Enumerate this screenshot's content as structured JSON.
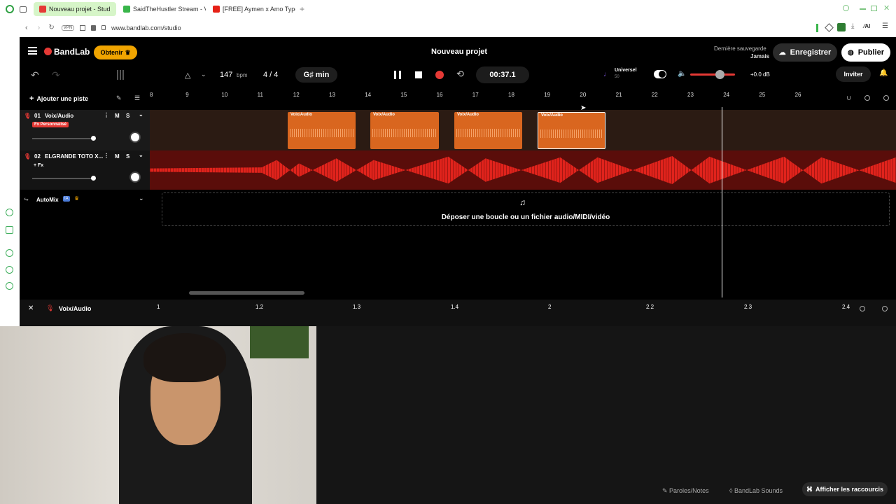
{
  "browser": {
    "tabs": [
      "Nouveau projet - Stud",
      "SaidTheHustler Stream - V",
      "[FREE] Aymen x Amo Type"
    ],
    "url": "www.bandlab.com/studio"
  },
  "header": {
    "brand": "BandLab",
    "get_label": "Obtenir",
    "project_title": "Nouveau projet",
    "save_caption": "Dernière sauvegarde",
    "save_value": "Jamais",
    "record_label": "Enregistrer",
    "publish_label": "Publier"
  },
  "toolbar": {
    "bpm_value": "147",
    "bpm_unit": "bpm",
    "time_signature": "4 / 4",
    "key": "G♯ min",
    "time": "00:37.1",
    "universal_label": "Universel",
    "universal_sub": "50",
    "volume_db": "+0.0 dB",
    "invite_label": "Inviter",
    "add_track_label": "Ajouter une piste"
  },
  "ruler": [
    "8",
    "9",
    "10",
    "11",
    "12",
    "13",
    "14",
    "15",
    "16",
    "17",
    "18",
    "19",
    "20",
    "21",
    "22",
    "23",
    "24",
    "25",
    "26"
  ],
  "tracks": [
    {
      "num": "01",
      "name": "Voix/Audio",
      "fx": "Fx Personnalisé",
      "m": "M",
      "s": "S"
    },
    {
      "num": "02",
      "name": "ELGRANDE TOTO X...",
      "fx": "+ Fx",
      "m": "M",
      "s": "S"
    }
  ],
  "clip_label": "Voix/Audio",
  "automix": {
    "label": "AutoMix",
    "badge": "IA"
  },
  "drop_text": "Déposer une boucle ou un fichier audio/MIDI/vidéo",
  "editor": {
    "track_name": "Voix/Audio",
    "ruler": [
      "1",
      "1.2",
      "1.3",
      "1.4",
      "2",
      "2.2",
      "2.3",
      "2.4"
    ]
  },
  "footer": {
    "lyrics_label": "Paroles/Notes",
    "sounds_label": "BandLab Sounds",
    "shortcuts_label": "Afficher les raccourcis"
  },
  "colors": {
    "accent": "#e53935",
    "clip": "#d9661f",
    "gold": "#f0a400",
    "wave_red": "#e0231c"
  }
}
